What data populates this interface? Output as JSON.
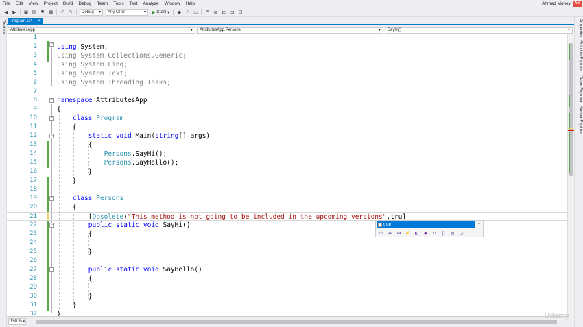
{
  "menu": {
    "items": [
      "File",
      "Edit",
      "View",
      "Project",
      "Build",
      "Debug",
      "Team",
      "Tools",
      "Test",
      "Analyze",
      "Window",
      "Help"
    ],
    "user": "Ahmad Mohey",
    "avatar_initials": "AM"
  },
  "toolbar": {
    "config": "Debug",
    "platform": "Any CPU",
    "start_label": "Start"
  },
  "side_panels": {
    "left": "Toolbox",
    "right": [
      "Properties",
      "Solution Explorer",
      "Team Explorer",
      "Server Explorer"
    ]
  },
  "tab": {
    "label": "Program.cs*"
  },
  "navbar": {
    "project": "AttributesApp",
    "type": "AttributesApp.Persons",
    "member": "SayHi()"
  },
  "code": {
    "line_numbers": [
      "1",
      "2",
      "3",
      "4",
      "5",
      "6",
      "7",
      "8",
      "9",
      "10",
      "11",
      "12",
      "13",
      "14",
      "15",
      "16",
      "17",
      "18",
      "19",
      "20",
      "21",
      "22",
      "23",
      "24",
      "25",
      "26",
      "27",
      "28",
      "29",
      "30",
      "31",
      "32"
    ]
  },
  "intellisense": {
    "selected": "true",
    "more": "..."
  },
  "status": {
    "zoom": "150 %"
  },
  "watermark": "Udemy",
  "colors": {
    "accent": "#007acc",
    "keyword": "#0000ff",
    "type": "#2b91af",
    "string": "#a31515",
    "change_marker": "#57a64a"
  }
}
